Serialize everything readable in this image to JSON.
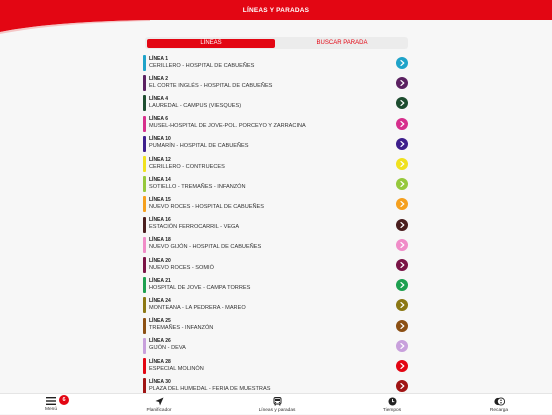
{
  "header": {
    "title": "LÍNEAS Y PARADAS",
    "color": "#e30613"
  },
  "segments": {
    "active": "LÍNEAS",
    "inactive": "BUSCAR PARADA"
  },
  "lines": [
    {
      "number": "LÍNEA 1",
      "name": "CERILLERO - HOSPITAL DE CABUEÑES",
      "color": "#1fa3c9"
    },
    {
      "number": "LÍNEA 2",
      "name": "EL CORTE INGLÉS - HOSPITAL DE CABUEÑES",
      "color": "#5b2161"
    },
    {
      "number": "LÍNEA 4",
      "name": "LAUREDAL - CAMPUS (VIESQUES)",
      "color": "#1d4d2f"
    },
    {
      "number": "LÍNEA 6",
      "name": "MUSEL-HOSPITAL DE JOVE-POL. PORCEYO Y ZARRACINA",
      "color": "#d62f8c"
    },
    {
      "number": "LÍNEA 10",
      "name": "PUMARÍN - HOSPITAL DE CABUEÑES",
      "color": "#3d1f8c"
    },
    {
      "number": "LÍNEA 12",
      "name": "CERILLERO - CONTRUECES",
      "color": "#f0e11e"
    },
    {
      "number": "LÍNEA 14",
      "name": "SOTIELLO - TREMAÑES - INFANZÓN",
      "color": "#96c83c"
    },
    {
      "number": "LÍNEA 15",
      "name": "NUEVO ROCES - HOSPITAL DE CABUEÑES",
      "color": "#f5a01e"
    },
    {
      "number": "LÍNEA 16",
      "name": "ESTACIÓN FERROCARRIL - VEGA",
      "color": "#4a1e1e"
    },
    {
      "number": "LÍNEA 18",
      "name": "NUEVO GIJÓN - HOSPITAL DE CABUEÑES",
      "color": "#f08cc8"
    },
    {
      "number": "LÍNEA 20",
      "name": "NUEVO ROCES - SOMIÓ",
      "color": "#7a1446"
    },
    {
      "number": "LÍNEA 21",
      "name": "HOSPITAL DE JOVE - CAMPA TORRES",
      "color": "#1ea050"
    },
    {
      "number": "LÍNEA 24",
      "name": "MONTEANA - LA PEDRERA - MAREO",
      "color": "#8c7814"
    },
    {
      "number": "LÍNEA 25",
      "name": "TREMAÑES - INFANZÓN",
      "color": "#8c5014"
    },
    {
      "number": "LÍNEA 26",
      "name": "GIJÓN - DEVA",
      "color": "#c8a0dc"
    },
    {
      "number": "LÍNEA 28",
      "name": "ESPECIAL MOLINÓN",
      "color": "#e30613"
    },
    {
      "number": "LÍNEA 30",
      "name": "PLAZA DEL HUMEDAL - FERIA DE MUESTRAS",
      "color": "#a01414"
    }
  ],
  "tabbar": {
    "menu": "Menú",
    "badge": "6",
    "planner": "Planificador",
    "lines": "Líneas y paradas",
    "times": "Tiempos",
    "recharge": "Recarga"
  }
}
